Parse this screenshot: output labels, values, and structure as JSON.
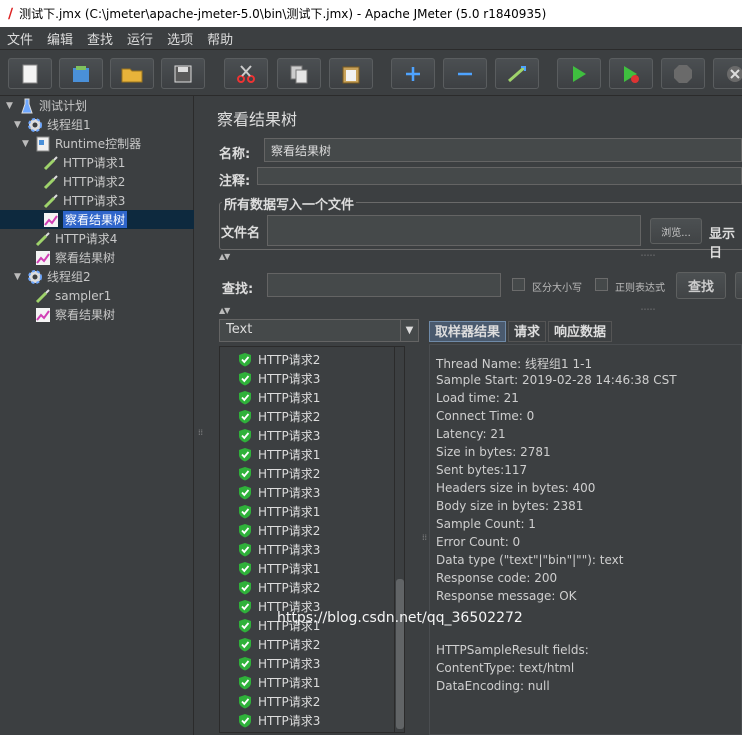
{
  "window": {
    "title": "测试下.jmx (C:\\jmeter\\apache-jmeter-5.0\\bin\\测试下.jmx) - Apache JMeter (5.0 r1840935)"
  },
  "menu": [
    "文件",
    "编辑",
    "查找",
    "运行",
    "选项",
    "帮助"
  ],
  "toolbar": [
    {
      "name": "new-icon"
    },
    {
      "name": "templates-icon"
    },
    {
      "name": "open-icon"
    },
    {
      "name": "save-icon"
    },
    {
      "name": "cut-icon"
    },
    {
      "name": "copy-icon"
    },
    {
      "name": "paste-icon"
    },
    {
      "name": "expand-icon"
    },
    {
      "name": "collapse-icon"
    },
    {
      "name": "toggle-icon"
    },
    {
      "name": "start-icon"
    },
    {
      "name": "start-no-pause-icon"
    },
    {
      "name": "stop-icon"
    },
    {
      "name": "shutdown-icon"
    }
  ],
  "tree": [
    {
      "label": "测试计划",
      "icon": "flask-icon"
    },
    {
      "label": "线程组1",
      "icon": "gear-icon"
    },
    {
      "label": "Runtime控制器",
      "icon": "controller-icon"
    },
    {
      "label": "HTTP请求1",
      "icon": "pipette-icon"
    },
    {
      "label": "HTTP请求2",
      "icon": "pipette-icon"
    },
    {
      "label": "HTTP请求3",
      "icon": "pipette-icon"
    },
    {
      "label": "察看结果树",
      "icon": "chart-icon"
    },
    {
      "label": "HTTP请求4",
      "icon": "pipette-icon"
    },
    {
      "label": "察看结果树",
      "icon": "chart-icon"
    },
    {
      "label": "线程组2",
      "icon": "gear-icon"
    },
    {
      "label": "sampler1",
      "icon": "pipette-icon"
    },
    {
      "label": "察看结果树",
      "icon": "chart-icon"
    }
  ],
  "panel": {
    "title": "察看结果树",
    "name_label": "名称:",
    "name_value": "察看结果树",
    "comment_label": "注释:",
    "file_group_title": "所有数据写入一个文件",
    "filename_label": "文件名",
    "browse_label": "浏览...",
    "log_label": "显示日",
    "search_label": "查找:",
    "case_label": "区分大小写",
    "regex_label": "正则表达式",
    "search_button": "查找",
    "renderer": "Text"
  },
  "results": [
    "HTTP请求2",
    "HTTP请求3",
    "HTTP请求1",
    "HTTP请求2",
    "HTTP请求3",
    "HTTP请求1",
    "HTTP请求2",
    "HTTP请求3",
    "HTTP请求1",
    "HTTP请求2",
    "HTTP请求3",
    "HTTP请求1",
    "HTTP请求2",
    "HTTP请求3",
    "HTTP请求1",
    "HTTP请求2",
    "HTTP请求3",
    "HTTP请求1",
    "HTTP请求2",
    "HTTP请求3"
  ],
  "tabs": [
    "取样器结果",
    "请求",
    "响应数据"
  ],
  "details": [
    "Thread Name: 线程组1 1-1",
    "Sample Start: 2019-02-28 14:46:38 CST",
    "Load time: 21",
    "Connect Time: 0",
    "Latency: 21",
    "Size in bytes: 2781",
    "Sent bytes:117",
    "Headers size in bytes: 400",
    "Body size in bytes: 2381",
    "Sample Count: 1",
    "Error Count: 0",
    "Data type (\"text\"|\"bin\"|\"\"): text",
    "Response code: 200",
    "Response message: OK",
    "",
    "",
    "HTTPSampleResult fields:",
    "ContentType: text/html",
    "DataEncoding: null"
  ],
  "watermark": "https://blog.csdn.net/qq_36502272"
}
